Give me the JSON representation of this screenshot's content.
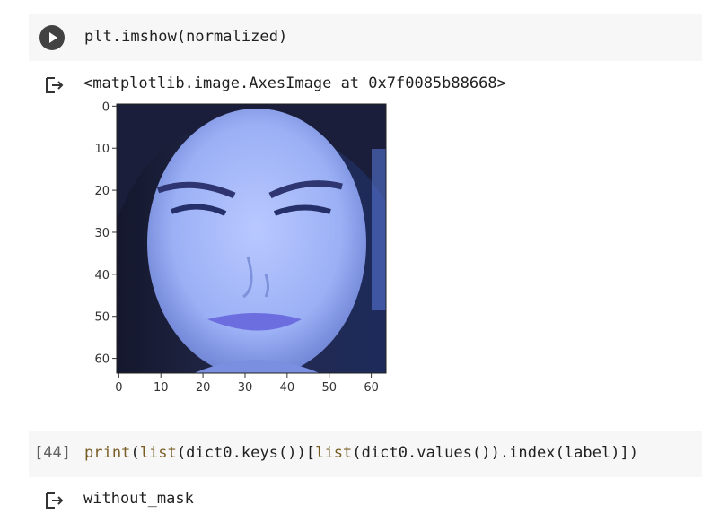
{
  "cells": [
    {
      "code": "plt.imshow(normalized)",
      "output": "<matplotlib.image.AxesImage at 0x7f0085b88668>"
    },
    {
      "exec_count": "[44]",
      "code_parts": {
        "fn1": "print",
        "p1": "(",
        "fn2": "list",
        "p2": "(dict0.keys())[",
        "fn3": "list",
        "p3": "(dict0.values()).index(label)])"
      },
      "output": "without_mask"
    }
  ],
  "chart_data": {
    "type": "image",
    "xticks": [
      "0",
      "10",
      "20",
      "30",
      "40",
      "50",
      "60"
    ],
    "yticks": [
      "0",
      "10",
      "20",
      "30",
      "40",
      "50",
      "60"
    ],
    "xlim": [
      -0.5,
      63.5
    ],
    "ylim": [
      63.5,
      -0.5
    ],
    "colors": {
      "face": "#9fb3ff",
      "hair": "#1a1e3a",
      "lips": "#6c6ee0",
      "background": "#2c3460"
    }
  },
  "icons": {
    "run": "play-icon",
    "output": "output-arrow-icon"
  }
}
